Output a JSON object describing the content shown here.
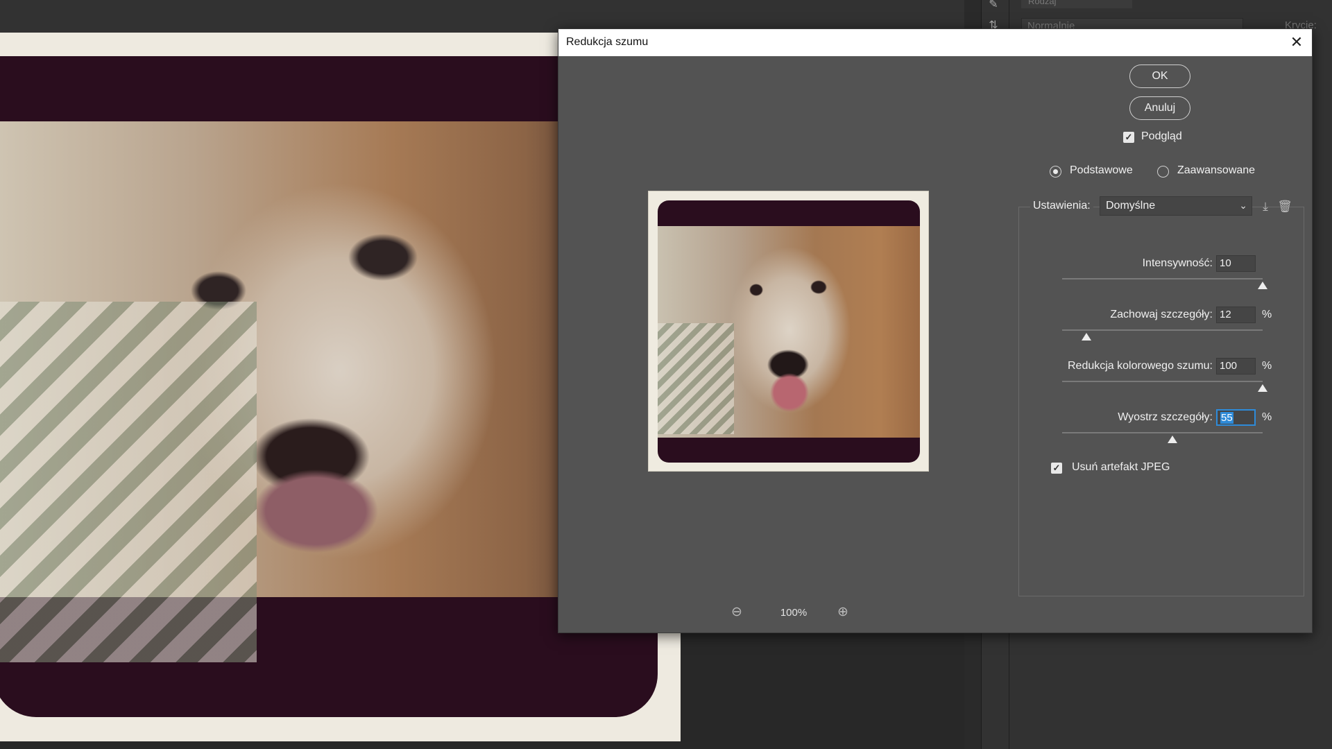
{
  "workspace": {
    "blend_mode": "Normalnie",
    "opacity_label": "Krycie:",
    "search_placeholder": "Rodzaj"
  },
  "dialog": {
    "title": "Redukcja szumu",
    "ok_label": "OK",
    "cancel_label": "Anuluj",
    "preview_label": "Podgląd",
    "preview_checked": true,
    "mode_basic": "Podstawowe",
    "mode_advanced": "Zaawansowane",
    "mode_selected": "Podstawowe",
    "settings_label": "Ustawienia:",
    "settings_value": "Domyślne",
    "zoom_value": "100%",
    "params": [
      {
        "label": "Intensywność:",
        "value": "10",
        "unit": "",
        "slider_fraction": 1.0
      },
      {
        "label": "Zachowaj szczegóły:",
        "value": "12",
        "unit": "%",
        "slider_fraction": 0.12
      },
      {
        "label": "Redukcja kolorowego szumu:",
        "value": "100",
        "unit": "%",
        "slider_fraction": 1.0
      },
      {
        "label": "Wyostrz szczegóły:",
        "value": "55",
        "unit": "%",
        "slider_fraction": 0.55
      }
    ],
    "jpeg_label": "Usuń artefakt JPEG",
    "jpeg_checked": true
  },
  "colors": {
    "dialog_bg": "#535353",
    "focus": "#2e8bd9"
  }
}
